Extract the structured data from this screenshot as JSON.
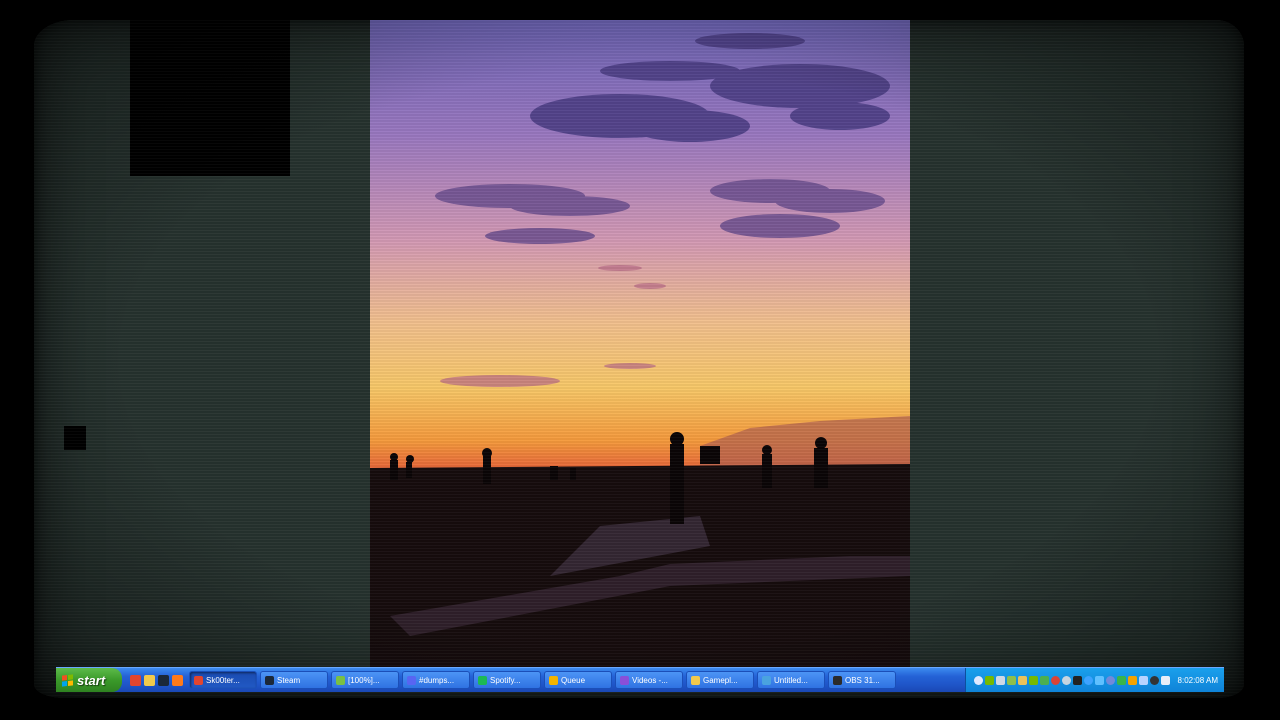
{
  "taskbar": {
    "start_label": "start",
    "quick_launch": [
      {
        "icon": "brave-icon",
        "color": "#e2452e"
      },
      {
        "icon": "folder-icon",
        "color": "#f2c94c"
      },
      {
        "icon": "steam-icon",
        "color": "#1b2838"
      },
      {
        "icon": "firefox-icon",
        "color": "#ff7a1a"
      }
    ],
    "tasks": [
      {
        "label": "Sk00ter...",
        "icon": "brave-icon",
        "color": "#e2452e",
        "active": true
      },
      {
        "label": "Steam",
        "icon": "steam-icon",
        "color": "#1b2838",
        "active": false
      },
      {
        "label": "[100%]...",
        "icon": "torrent-icon",
        "color": "#7ac043",
        "active": false
      },
      {
        "label": "#dumps...",
        "icon": "discord-icon",
        "color": "#5865f2",
        "active": false
      },
      {
        "label": "Spotify...",
        "icon": "spotify-icon",
        "color": "#1db954",
        "active": false
      },
      {
        "label": "Queue",
        "icon": "queue-icon",
        "color": "#f4b400",
        "active": false
      },
      {
        "label": "Videos -...",
        "icon": "video-icon",
        "color": "#8a4fd8",
        "active": false
      },
      {
        "label": "Gamepl...",
        "icon": "folder-icon",
        "color": "#f2c94c",
        "active": false
      },
      {
        "label": "Untitled...",
        "icon": "paint-icon",
        "color": "#4aa3df",
        "active": false
      },
      {
        "label": "OBS 31...",
        "icon": "obs-icon",
        "color": "#2b2b2b",
        "active": false
      }
    ],
    "tray_icons": [
      {
        "icon": "tray-arrow-icon",
        "color": "#dfe9ff"
      },
      {
        "icon": "tray-gpu-icon",
        "color": "#76b900"
      },
      {
        "icon": "tray-usb-icon",
        "color": "#cfd8e6"
      },
      {
        "icon": "tray-box-icon",
        "color": "#8fbf4a"
      },
      {
        "icon": "tray-folder-icon",
        "color": "#e9c25a"
      },
      {
        "icon": "tray-nvidia-icon",
        "color": "#76b900"
      },
      {
        "icon": "tray-shield-icon",
        "color": "#4caf50"
      },
      {
        "icon": "tray-chrome-icon",
        "color": "#db4437"
      },
      {
        "icon": "tray-steam-icon",
        "color": "#c7d5e0"
      },
      {
        "icon": "tray-m-icon",
        "color": "#222222"
      },
      {
        "icon": "tray-globe-icon",
        "color": "#3da3ff"
      },
      {
        "icon": "tray-sync-icon",
        "color": "#5fc0ff"
      },
      {
        "icon": "tray-discord-icon",
        "color": "#7289da"
      },
      {
        "icon": "tray-green-icon",
        "color": "#39b54a"
      },
      {
        "icon": "tray-flag-icon",
        "color": "#f4a300"
      },
      {
        "icon": "tray-network-icon",
        "color": "#b7d3ff"
      },
      {
        "icon": "tray-obs-icon",
        "color": "#333333"
      },
      {
        "icon": "tray-volume-icon",
        "color": "#e8eef8"
      }
    ],
    "clock": "8:02:08 AM"
  },
  "colors": {
    "desktop": "#26322e",
    "sky_top": "#6b5ea8",
    "sky_mid": "#d79aa0",
    "sky_low": "#f6b95a",
    "horizon": "#f08a3a"
  }
}
